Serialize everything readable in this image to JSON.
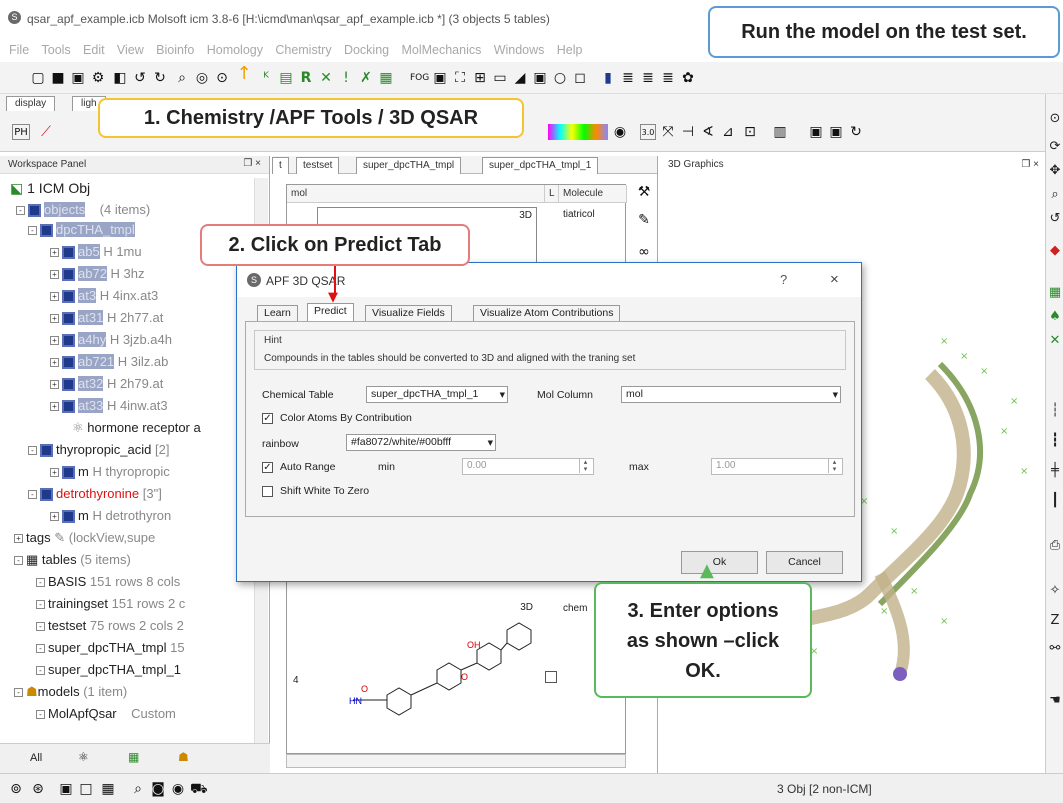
{
  "window": {
    "title": "qsar_apf_example.icb Molsoft icm 3.8-6  [H:\\icmd\\man\\qsar_apf_example.icb *] (3 objects 5 tables)"
  },
  "menu": [
    "File",
    "Tools",
    "Edit",
    "View",
    "Bioinfo",
    "Homology",
    "Chemistry",
    "Docking",
    "MolMechanics",
    "Windows",
    "Help"
  ],
  "panel_tabs": {
    "display": "display",
    "light": "ligh"
  },
  "workspace": {
    "title": "Workspace Panel",
    "controls": "❐ ×",
    "root": "1 ICM Obj",
    "rows": [
      {
        "name": "objects",
        "info": "(4 items)"
      },
      {
        "name": "dpcTHA_tmpl",
        "info": ""
      },
      {
        "name": "ab5",
        "info": "H  1mu"
      },
      {
        "name": "ab72",
        "info": "H  3hz"
      },
      {
        "name": "at3",
        "info": "H  4inx.at3"
      },
      {
        "name": "at31",
        "info": "H  2h77.at"
      },
      {
        "name": "a4hy",
        "info": "H  3jzb.a4h"
      },
      {
        "name": "ab721",
        "info": "H  3ilz.ab"
      },
      {
        "name": "at32",
        "info": "H  2h79.at"
      },
      {
        "name": "at33",
        "info": "H  4inw.at3"
      },
      {
        "name": "hormone receptor a",
        "info": ""
      },
      {
        "name": "thyropropic_acid",
        "info": "[2]"
      },
      {
        "name": "m",
        "info": "H  thyropropic"
      },
      {
        "name": "detrothyronine",
        "info": "[3\"] "
      },
      {
        "name": "m",
        "info": "H  detrothyron"
      },
      {
        "name": "tags",
        "info": "(lockView,supe"
      },
      {
        "name": "tables",
        "info": "(5 items)"
      },
      {
        "name": "BASIS",
        "info": "151 rows 8 cols"
      },
      {
        "name": "trainingset",
        "info": "151 rows 2 c"
      },
      {
        "name": "testset",
        "info": "75 rows 2 cols 2"
      },
      {
        "name": "super_dpcTHA_tmpl",
        "info": "15"
      },
      {
        "name": "super_dpcTHA_tmpl_1",
        "info": ""
      },
      {
        "name": "models",
        "info": "(1 item)"
      },
      {
        "name": "MolApfQsar",
        "info": "Custom"
      }
    ],
    "bottom_tab": "All"
  },
  "tables_panel": {
    "tabs": [
      "t",
      "testset",
      "super_dpcTHA_tmpl",
      "super_dpcTHA_tmpl_1"
    ],
    "columns": [
      "mol",
      "L",
      "Molecule"
    ],
    "cells": {
      "tag3d": "3D",
      "first_mol": "tiatricol",
      "second_mol": "chem",
      "row_index": "4"
    }
  },
  "graphics_panel": {
    "title": "3D Graphics",
    "controls": "❐ ×"
  },
  "status": {
    "text": "3  Obj [2 non-ICM]"
  },
  "dialog": {
    "title": "APF 3D QSAR",
    "help": "?",
    "close": "×",
    "tabs": [
      "Learn",
      "Predict",
      "Visualize Fields",
      "Visualize Atom Contributions"
    ],
    "active_tab": "Predict",
    "hint_label": "Hint",
    "hint_text": "Compounds in the tables should be converted to 3D and aligned with the traning set",
    "chemical_table_label": "Chemical Table",
    "chemical_table_value": "super_dpcTHA_tmpl_1",
    "mol_column_label": "Mol Column",
    "mol_column_value": "mol",
    "color_atoms_label": "Color Atoms By Contribution",
    "color_atoms_checked": true,
    "rainbow_label": "rainbow",
    "rainbow_value": "#fa8072/white/#00bfff",
    "auto_range_label": "Auto Range",
    "auto_range_checked": true,
    "min_label": "min",
    "min_value": "0.00",
    "max_label": "max",
    "max_value": "1.00",
    "shift_white_label": "Shift White To Zero",
    "shift_white_checked": false,
    "ok_label": "Ok",
    "cancel_label": "Cancel"
  },
  "callouts": {
    "step1": "1. Chemistry /APF Tools / 3D QSAR",
    "step2": "2. Click on Predict Tab",
    "step3_line1": "3. Enter options",
    "step3_line2": "as shown –click",
    "step3_line3": "OK.",
    "run": "Run the model on the test set."
  },
  "colors": {
    "red_callout": "#e57c7c",
    "yellow_callout": "#f4c430",
    "blue_callout": "#5b9bd5",
    "green_callout": "#5cb85c",
    "selection": "#9aa4c4",
    "accent": "#2a72c8"
  }
}
